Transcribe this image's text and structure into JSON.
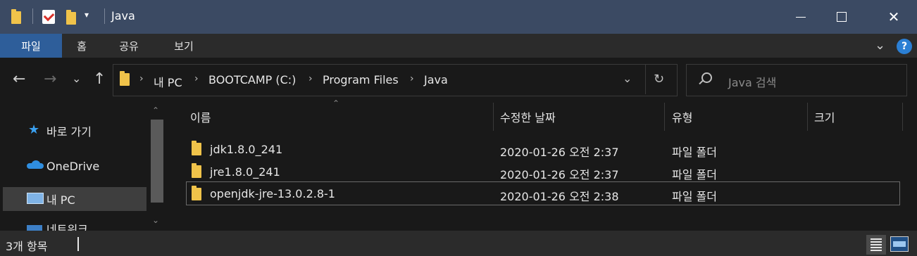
{
  "window": {
    "title": "Java",
    "minimize_icon": "minimize-icon",
    "maximize_icon": "maximize-icon",
    "close_icon": "close-icon"
  },
  "ribbon": {
    "tabs": [
      "파일",
      "홈",
      "공유",
      "보기"
    ],
    "expand_icon": "chevron-down-icon",
    "help_label": "?"
  },
  "address": {
    "crumbs": [
      "내 PC",
      "BOOTCAMP (C:)",
      "Program Files",
      "Java"
    ],
    "search_placeholder": "Java 검색"
  },
  "sidebar": {
    "items": [
      {
        "label": "바로 가기",
        "icon": "star-icon"
      },
      {
        "label": "OneDrive",
        "icon": "cloud-icon"
      },
      {
        "label": "내 PC",
        "icon": "computer-icon"
      },
      {
        "label": "네트워크",
        "icon": "network-icon"
      }
    ]
  },
  "table": {
    "columns": [
      "이름",
      "수정한 날짜",
      "유형",
      "크기"
    ],
    "rows": [
      {
        "name": "jdk1.8.0_241",
        "modified": "2020-01-26 오전 2:37",
        "type": "파일 폴더",
        "size": ""
      },
      {
        "name": "jre1.8.0_241",
        "modified": "2020-01-26 오전 2:37",
        "type": "파일 폴더",
        "size": ""
      },
      {
        "name": "openjdk-jre-13.0.2.8-1",
        "modified": "2020-01-26 오전 2:38",
        "type": "파일 폴더",
        "size": ""
      }
    ]
  },
  "status": {
    "count_text": "3개 항목"
  },
  "colors": {
    "titlebar": "#3b4a63",
    "ribbon_active": "#2e5e9a",
    "folder": "#f0c34a",
    "help": "#2b7fd4"
  }
}
